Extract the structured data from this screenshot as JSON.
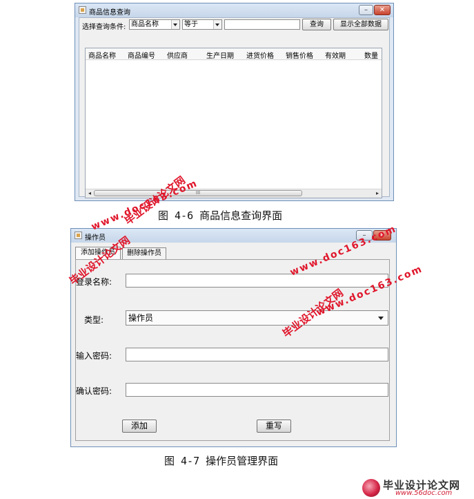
{
  "window1": {
    "title": "商品信息查询",
    "controls": {
      "minimize": "–",
      "maximize": "□",
      "close": "✕"
    },
    "query_label": "选择查询条件:",
    "field_select": "商品名称",
    "operator_select": "等于",
    "query_value": "",
    "query_button": "查询",
    "show_all_button": "显示全部数据",
    "columns": [
      "商品名称",
      "商品编号",
      "供应商",
      "生产日期",
      "进货价格",
      "销售价格",
      "有效期",
      "数量"
    ],
    "scroll_left": "◂",
    "scroll_right": "▸",
    "scroll_grip": "III"
  },
  "caption1": "图 4-6 商品信息查询界面",
  "window2": {
    "title": "操作员",
    "controls": {
      "minimize": "–",
      "maximize": "□",
      "close": "✕"
    },
    "tabs": [
      "添加操作员",
      "删除操作员"
    ],
    "fields": {
      "login_label": "登录名称:",
      "type_label": "类型:",
      "type_value": "操作员",
      "password_label": "输入密码:",
      "confirm_label": "确认密码:"
    },
    "add_button": "添加",
    "reset_button": "重写"
  },
  "caption2": "图 4-7 操作员管理界面",
  "watermarks": {
    "cn": "毕业设计论文网",
    "url": "www.doc163.com"
  },
  "logo": {
    "brand": "毕业设计论文网",
    "site": "www.56doc.com"
  },
  "colors": {
    "watermark": "#e0162b",
    "close_button": "#c7432e",
    "title_bar": "#c6d6ea"
  }
}
